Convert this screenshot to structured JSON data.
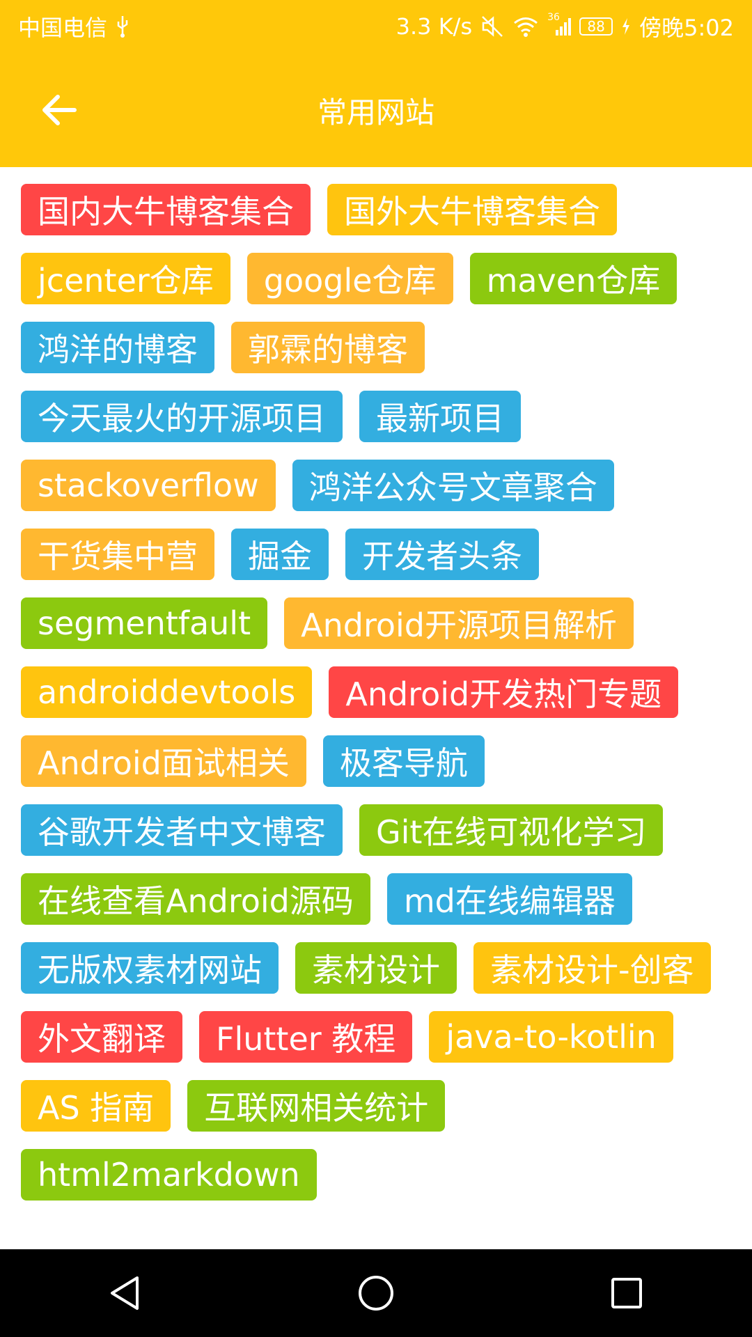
{
  "status_bar": {
    "carrier": "中国电信",
    "network_speed": "3.3 K/s",
    "signal_type": "36",
    "battery": "88",
    "time": "傍晚5:02",
    "icons": [
      "usb-icon",
      "mute-icon",
      "wifi-icon",
      "signal-icon",
      "battery-icon",
      "charging-icon"
    ]
  },
  "header": {
    "title": "常用网站",
    "back_icon": "arrow-left-icon"
  },
  "tags": [
    {
      "label": "国内大牛博客集合",
      "color": "#FF4646"
    },
    {
      "label": "国外大牛博客集合",
      "color": "#FFC40F"
    },
    {
      "label": "jcenter仓库",
      "color": "#FFC40F"
    },
    {
      "label": "google仓库",
      "color": "#FFB830"
    },
    {
      "label": "maven仓库",
      "color": "#8CC90F"
    },
    {
      "label": "鸿洋的博客",
      "color": "#33AEE0"
    },
    {
      "label": "郭霖的博客",
      "color": "#FFB830"
    },
    {
      "label": "今天最火的开源项目",
      "color": "#33AEE0"
    },
    {
      "label": "最新项目",
      "color": "#33AEE0"
    },
    {
      "label": "stackoverflow",
      "color": "#FFB830"
    },
    {
      "label": "鸿洋公众号文章聚合",
      "color": "#33AEE0"
    },
    {
      "label": "干货集中营",
      "color": "#FFB830"
    },
    {
      "label": "掘金",
      "color": "#33AEE0"
    },
    {
      "label": "开发者头条",
      "color": "#33AEE0"
    },
    {
      "label": "segmentfault",
      "color": "#8CC90F"
    },
    {
      "label": "Android开源项目解析",
      "color": "#FFB830"
    },
    {
      "label": "androiddevtools",
      "color": "#FFC40F"
    },
    {
      "label": "Android开发热门专题",
      "color": "#FF4646"
    },
    {
      "label": "Android面试相关",
      "color": "#FFB830"
    },
    {
      "label": "极客导航",
      "color": "#33AEE0"
    },
    {
      "label": "谷歌开发者中文博客",
      "color": "#33AEE0"
    },
    {
      "label": "Git在线可视化学习",
      "color": "#8CC90F"
    },
    {
      "label": "在线查看Android源码",
      "color": "#8CC90F"
    },
    {
      "label": "md在线编辑器",
      "color": "#33AEE0"
    },
    {
      "label": "无版权素材网站",
      "color": "#33AEE0"
    },
    {
      "label": "素材设计",
      "color": "#8CC90F"
    },
    {
      "label": "素材设计-创客",
      "color": "#FFC40F"
    },
    {
      "label": "外文翻译",
      "color": "#FF4646"
    },
    {
      "label": "Flutter 教程",
      "color": "#FF4646"
    },
    {
      "label": "java-to-kotlin",
      "color": "#FFC40F"
    },
    {
      "label": "AS 指南",
      "color": "#FFC40F"
    },
    {
      "label": "互联网相关统计",
      "color": "#8CC90F"
    },
    {
      "label": "html2markdown",
      "color": "#8CC90F"
    }
  ],
  "nav_bar": {
    "buttons": [
      "back-triangle-icon",
      "home-circle-icon",
      "recents-square-icon"
    ]
  }
}
